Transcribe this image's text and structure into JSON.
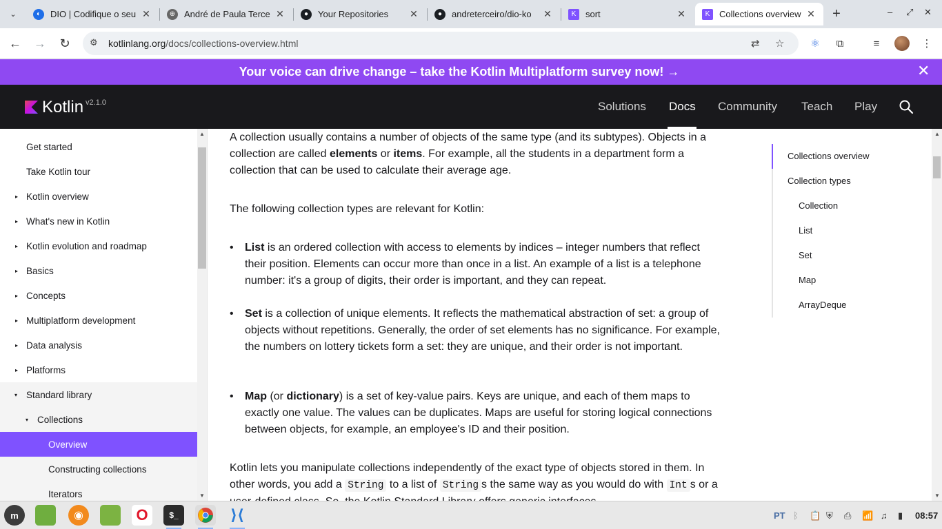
{
  "browser": {
    "tabs": [
      {
        "title": "DIO | Codifique o seu",
        "fav_color": "#1e6ee8",
        "fav_glyph": "◐",
        "icon": "dio-icon"
      },
      {
        "title": "André de Paula Terce",
        "fav_color": "#555555",
        "fav_glyph": "⊕",
        "icon": "globe-icon"
      },
      {
        "title": "Your Repositories",
        "fav_color": "#1b1f23",
        "fav_glyph": "●",
        "icon": "github-icon"
      },
      {
        "title": "andreterceiro/dio-ko",
        "fav_color": "#1b1f23",
        "fav_glyph": "●",
        "icon": "github-icon"
      },
      {
        "title": "sort",
        "fav_color": "#7f52ff",
        "fav_glyph": "K",
        "icon": "kotlin-icon"
      },
      {
        "title": "Collections overview",
        "fav_color": "#7f52ff",
        "fav_glyph": "K",
        "icon": "kotlin-icon"
      }
    ],
    "close_glyph": "✕",
    "new_tab_glyph": "+",
    "url_host": "kotlinlang.org",
    "url_path": "/docs/collections-overview.html"
  },
  "banner": {
    "text": "Your voice can drive change – take the Kotlin Multiplatform survey now! →",
    "close_glyph": "✕"
  },
  "header": {
    "logo_text": "Kotlin",
    "version": "v2.1.0",
    "nav": [
      "Solutions",
      "Docs",
      "Community",
      "Teach",
      "Play"
    ],
    "active_nav": "Docs"
  },
  "sidebar": {
    "items": [
      {
        "label": "Get started",
        "level": 0,
        "caret": ""
      },
      {
        "label": "Take Kotlin tour",
        "level": 0,
        "caret": ""
      },
      {
        "label": "Kotlin overview",
        "level": 0,
        "caret": "▸"
      },
      {
        "label": "What's new in Kotlin",
        "level": 0,
        "caret": "▸"
      },
      {
        "label": "Kotlin evolution and roadmap",
        "level": 0,
        "caret": "▸"
      },
      {
        "label": "Basics",
        "level": 0,
        "caret": "▸"
      },
      {
        "label": "Concepts",
        "level": 0,
        "caret": "▸"
      },
      {
        "label": "Multiplatform development",
        "level": 0,
        "caret": "▸"
      },
      {
        "label": "Data analysis",
        "level": 0,
        "caret": "▸"
      },
      {
        "label": "Platforms",
        "level": 0,
        "caret": "▸"
      },
      {
        "label": "Standard library",
        "level": 0,
        "caret": "▾"
      },
      {
        "label": "Collections",
        "level": 1,
        "caret": "▾"
      },
      {
        "label": "Overview",
        "level": 2,
        "caret": ""
      },
      {
        "label": "Constructing collections",
        "level": 2,
        "caret": ""
      },
      {
        "label": "Iterators",
        "level": 2,
        "caret": ""
      }
    ]
  },
  "article": {
    "intro_1": "A collection usually contains a number of objects of the same type (and its subtypes). Objects in a collection are called ",
    "intro_elements": "elements",
    "intro_or": " or ",
    "intro_items": "items",
    "intro_2": ". For example, all the students in a department form a collection that can be used to calculate their average age.",
    "types_intro": "The following collection types are relevant for Kotlin:",
    "list_term": "List",
    "list_text": " is an ordered collection with access to elements by indices – integer numbers that reflect their position. Elements can occur more than once in a list. An example of a list is a telephone number: it's a group of digits, their order is important, and they can repeat.",
    "set_term": "Set",
    "set_text": " is a collection of unique elements. It reflects the mathematical abstraction of set: a group of objects without repetitions. Generally, the order of set elements has no significance. For example, the numbers on lottery tickets form a set: they are unique, and their order is not important.",
    "map_term": "Map",
    "map_paren_open": " (or ",
    "map_term2": "dictionary",
    "map_text": ") is a set of key-value pairs. Keys are unique, and each of them maps to exactly one value. The values can be duplicates. Maps are useful for storing logical connections between objects, for example, an employee's ID and their position.",
    "outro_1": "Kotlin lets you manipulate collections independently of the exact type of objects stored in them. In other words, you add a ",
    "outro_code1": "String",
    "outro_2": " to a list of ",
    "outro_code2": "String",
    "outro_3": "s the same way as you would do with ",
    "outro_code3": "Int",
    "outro_4": "s or a user-defined class. So, the Kotlin Standard Library offers generic interfaces"
  },
  "toc": {
    "items": [
      {
        "label": "Collections overview",
        "level": 0
      },
      {
        "label": "Collection types",
        "level": 0
      },
      {
        "label": "Collection",
        "level": 1
      },
      {
        "label": "List",
        "level": 1
      },
      {
        "label": "Set",
        "level": 1
      },
      {
        "label": "Map",
        "level": 1
      },
      {
        "label": "ArrayDeque",
        "level": 1
      }
    ]
  },
  "taskbar": {
    "keyboard_layout": "PT",
    "clock": "08:57"
  },
  "colors": {
    "accent": "#7f52ff",
    "banner": "#8f49f2",
    "header": "#19191c"
  }
}
